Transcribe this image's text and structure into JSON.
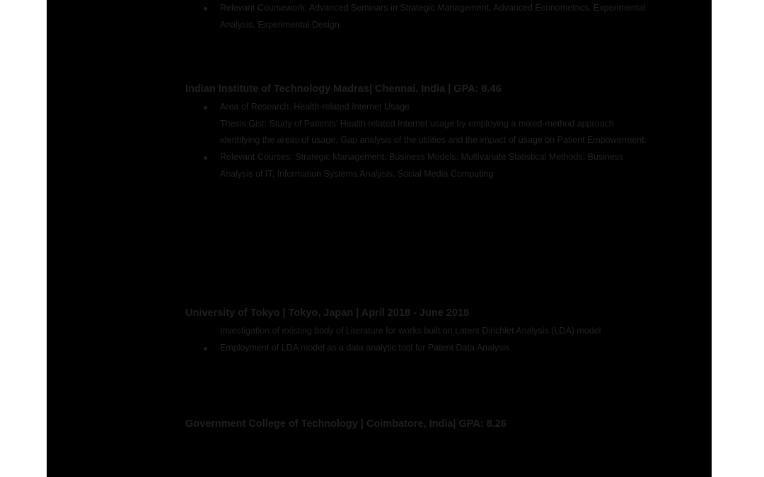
{
  "sections": [
    {
      "heading": "",
      "items": [
        {
          "text": "Relevant Coursework: Advanced Seminars in Strategic Management, Advanced Econometrics, Experimental Analysis, Experimental Design",
          "bullet": true
        }
      ]
    },
    {
      "heading": "Indian Institute of Technology Madras| Chennai, India | GPA: 8.46",
      "items": [
        {
          "text": "Area of Research: Health-related Internet Usage",
          "bullet": true
        },
        {
          "text": "Thesis Gist: Study of Patients’ Health related Internet usage by employing a mixed-method approach identifying the areas of usage, Gap analysis of the utilities and the impact of usage on Patient Empowerment.",
          "bullet": false
        },
        {
          "text": "Relevant Courses: Strategic Management, Business Models, Multivariate Statistical Methods, Business Analysis of IT, Information Systems Analysis, Social Media Computing",
          "bullet": true
        }
      ]
    },
    {
      "heading": "University of Tokyo | Tokyo, Japan | April 2018 - June 2018",
      "items": [
        {
          "text": "Investigation of existing body of Literature for works built on Latent Dirichlet Analysis (LDA) model",
          "bullet": false
        },
        {
          "text": "Employment of LDA model as a data analytic tool for Patent Data Analysis",
          "bullet": true
        }
      ]
    },
    {
      "heading": "Government College of Technology | Coimbatore, India| GPA: 8.26",
      "items": []
    }
  ]
}
